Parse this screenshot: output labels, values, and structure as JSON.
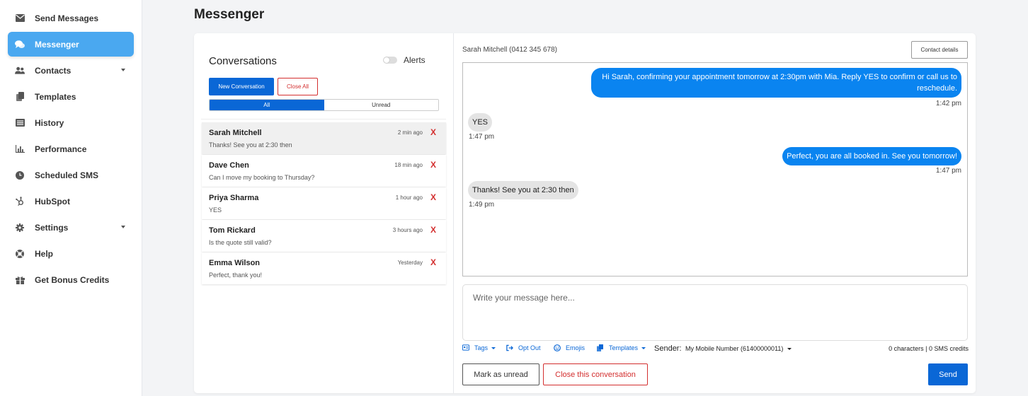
{
  "sidebar": {
    "items": [
      {
        "label": "Send Messages",
        "icon": "envelope-icon"
      },
      {
        "label": "Messenger",
        "icon": "chat-bubbles-icon",
        "active": true
      },
      {
        "label": "Contacts",
        "icon": "users-icon",
        "has_caret": true
      },
      {
        "label": "Templates",
        "icon": "copy-icon"
      },
      {
        "label": "History",
        "icon": "list-icon"
      },
      {
        "label": "Performance",
        "icon": "bar-chart-icon"
      },
      {
        "label": "Scheduled SMS",
        "icon": "clock-icon"
      },
      {
        "label": "HubSpot",
        "icon": "hubspot-icon"
      },
      {
        "label": "Settings",
        "icon": "gear-icon",
        "has_caret": true
      },
      {
        "label": "Help",
        "icon": "life-ring-icon"
      },
      {
        "label": "Get Bonus Credits",
        "icon": "gift-icon"
      }
    ]
  },
  "page": {
    "title": "Messenger"
  },
  "conversations": {
    "title": "Conversations",
    "alerts_label": "Alerts",
    "alerts_enabled": false,
    "new_button": "New Conversation",
    "close_all_button": "Close All",
    "filters": {
      "all": "All",
      "unread": "Unread",
      "active": "all"
    },
    "items": [
      {
        "name": "Sarah Mitchell",
        "time": "2 min ago",
        "preview": "Thanks! See you at 2:30 then",
        "active": true
      },
      {
        "name": "Dave Chen",
        "time": "18 min ago",
        "preview": "Can I move my booking to Thursday?"
      },
      {
        "name": "Priya Sharma",
        "time": "1 hour ago",
        "preview": "YES"
      },
      {
        "name": "Tom Rickard",
        "time": "3 hours ago",
        "preview": "Is the quote still valid?"
      },
      {
        "name": "Emma Wilson",
        "time": "Yesterday",
        "preview": "Perfect, thank you!"
      }
    ],
    "close_glyph": "X"
  },
  "chat": {
    "contact": "Sarah Mitchell (0412 345 678)",
    "details_button": "Contact details",
    "messages": [
      {
        "direction": "out",
        "text": "Hi Sarah, confirming your appointment tomorrow at 2:30pm with Mia. Reply YES to confirm or call us to reschedule.",
        "time": "1:42 pm"
      },
      {
        "direction": "in",
        "text": "YES",
        "time": "1:47 pm"
      },
      {
        "direction": "out",
        "text": "Perfect, you are all booked in. See you tomorrow!",
        "time": "1:47 pm"
      },
      {
        "direction": "in",
        "text": "Thanks! See you at 2:30 then",
        "time": "1:49 pm"
      }
    ],
    "composer_placeholder": "Write your message here...",
    "toolbar": {
      "tags": "Tags",
      "opt_out": "Opt Out",
      "emojis": "Emojis",
      "templates": "Templates",
      "sender_label": "Sender:",
      "sender_value": "My Mobile Number (61400000011)",
      "counter": "0 characters | 0 SMS credits"
    },
    "mark_unread_button": "Mark as unread",
    "close_conversation_button": "Close this conversation",
    "send_button": "Send"
  },
  "colors": {
    "accent": "#0a67d6",
    "active_nav": "#4aa8f0",
    "danger": "#d32f2f",
    "outgoing_bubble": "#0a84f0",
    "incoming_bubble": "#e4e4e4"
  }
}
